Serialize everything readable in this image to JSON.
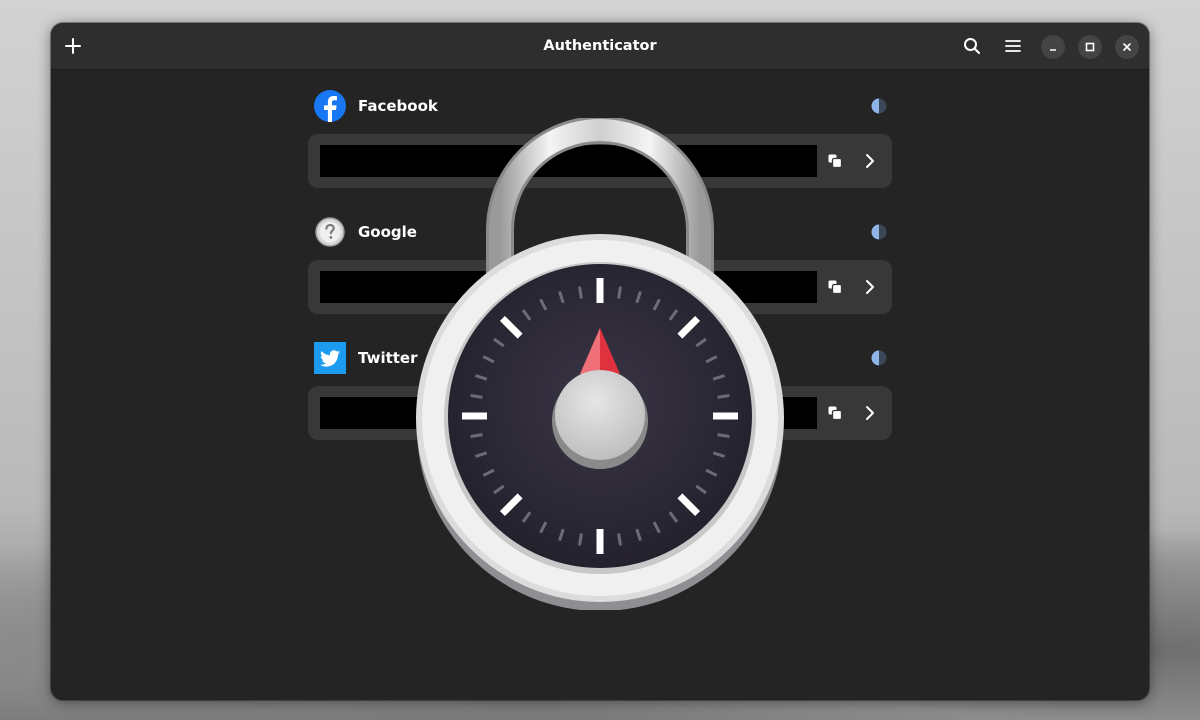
{
  "window": {
    "title": "Authenticator"
  },
  "headerbar": {
    "add_icon": "plus-icon",
    "search_icon": "search-icon",
    "menu_icon": "hamburger-menu-icon",
    "window_controls": [
      "minimize-icon",
      "maximize-icon",
      "close-icon"
    ]
  },
  "accounts": [
    {
      "provider": "Facebook",
      "logo": "facebook-logo",
      "code": "",
      "timer_progress": 0.55
    },
    {
      "provider": "Google",
      "logo": "unknown-provider-icon",
      "code": "",
      "timer_progress": 0.55
    },
    {
      "provider": "Twitter",
      "logo": "twitter-logo",
      "code": "",
      "timer_progress": 0.55
    }
  ],
  "overlay": {
    "icon": "padlock-combination-icon"
  },
  "colors": {
    "window_bg": "#242424",
    "headerbar_bg": "#2e2e2e",
    "row_bg": "#383838",
    "facebook_blue": "#1877f2",
    "twitter_blue": "#1d9bf0",
    "timer_blue": "#8fb4e8",
    "lock_red": "#e0313f"
  }
}
